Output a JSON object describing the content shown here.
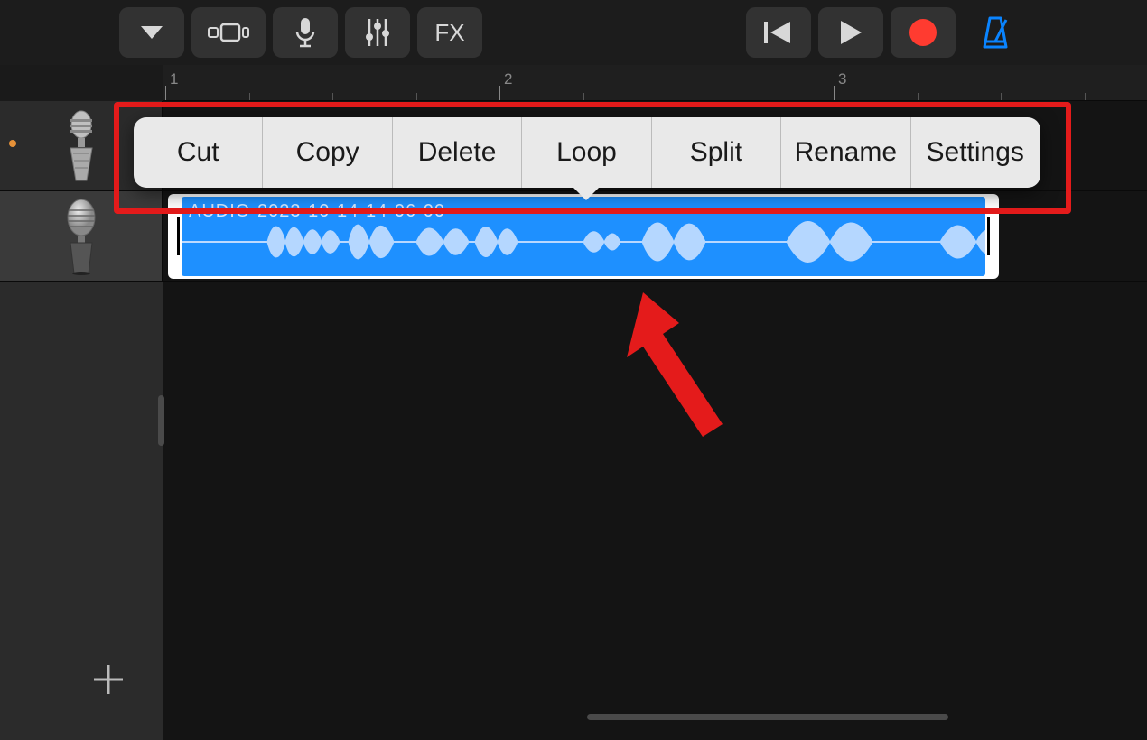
{
  "toolbar": {
    "fx_label": "FX"
  },
  "ruler": {
    "marks": [
      "1",
      "2",
      "3"
    ]
  },
  "context_menu": {
    "items": [
      "Cut",
      "Copy",
      "Delete",
      "Loop",
      "Split",
      "Rename",
      "Settings"
    ]
  },
  "clip": {
    "label": "AUDIO-2023-10-14-14-06-00"
  },
  "colors": {
    "record": "#ff3b30",
    "metronome": "#0a84ff",
    "clip_bg": "#1e90ff"
  }
}
